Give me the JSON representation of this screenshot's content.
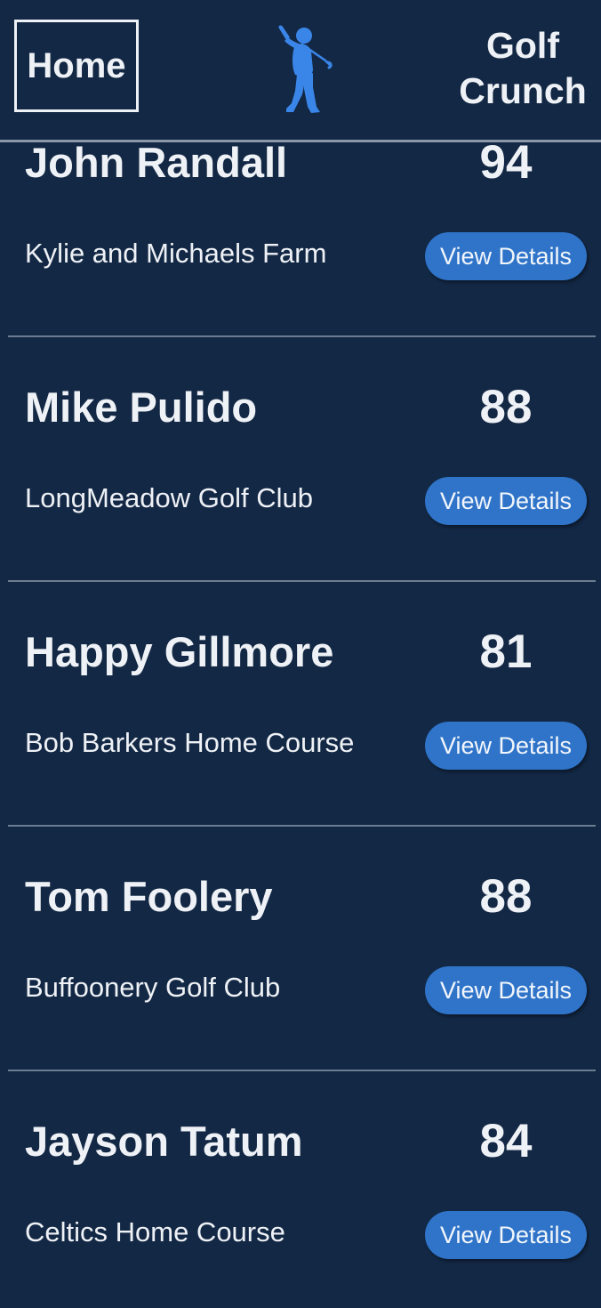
{
  "header": {
    "home_label": "Home",
    "logo_icon": "golfer-swing-icon",
    "app_title": "Golf\nCrunch"
  },
  "colors": {
    "background": "#132845",
    "button": "#2f74c9",
    "logo": "#3a86e8",
    "text": "#eef1f5",
    "divider": "#6c7d91"
  },
  "rounds": [
    {
      "player": "John Randall",
      "score": "94",
      "course": "Kylie and Michaels Farm",
      "button_label": "View Details"
    },
    {
      "player": "Mike Pulido",
      "score": "88",
      "course": "LongMeadow Golf Club",
      "button_label": "View Details"
    },
    {
      "player": "Happy Gillmore",
      "score": "81",
      "course": "Bob Barkers Home Course",
      "button_label": "View Details"
    },
    {
      "player": "Tom Foolery",
      "score": "88",
      "course": "Buffoonery Golf Club",
      "button_label": "View Details"
    },
    {
      "player": "Jayson Tatum",
      "score": "84",
      "course": "Celtics Home Course",
      "button_label": "View Details"
    }
  ]
}
